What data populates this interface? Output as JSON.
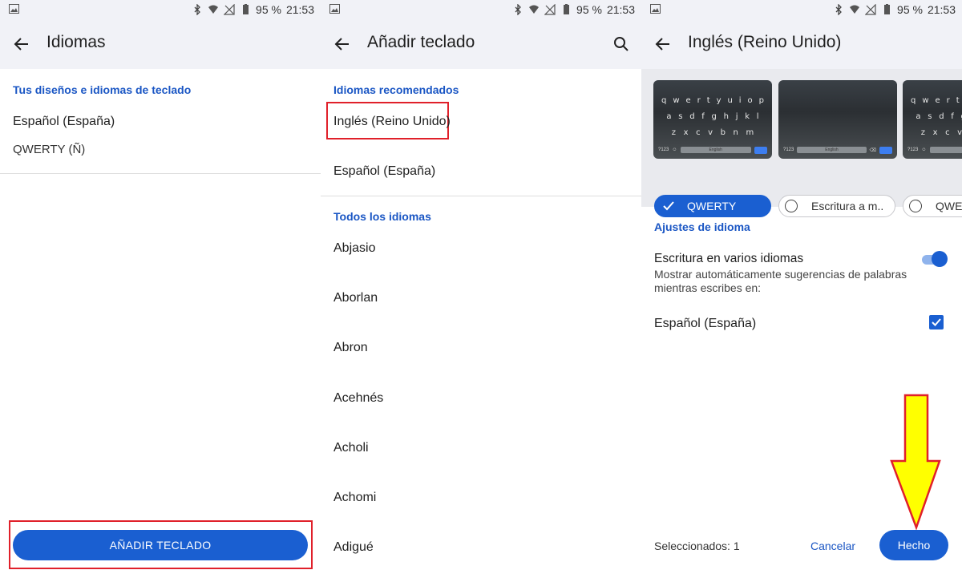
{
  "status_bar": {
    "battery": "95 %",
    "time": "21:53"
  },
  "panel1": {
    "title": "Idiomas",
    "section_header": "Tus diseños e idiomas de teclado",
    "language": "Español (España)",
    "layout": "QWERTY (Ñ)",
    "add_button": "AÑADIR TECLADO"
  },
  "panel2": {
    "title": "Añadir teclado",
    "recommended_header": "Idiomas recomendados",
    "recommended": [
      "Inglés (Reino Unido)",
      "Español (España)"
    ],
    "all_header": "Todos los idiomas",
    "languages": [
      "Abjasio",
      "Aborlan",
      "Abron",
      "Acehnés",
      "Acholi",
      "Achomi",
      "Adigué"
    ]
  },
  "panel3": {
    "title": "Inglés (Reino Unido)",
    "layout_options": [
      "QWERTY",
      "Escritura a m..",
      "QWE"
    ],
    "selected_layout": "QWERTY",
    "keyboard_rows": [
      [
        "q",
        "w",
        "e",
        "r",
        "t",
        "y",
        "u",
        "i",
        "o",
        "p"
      ],
      [
        "a",
        "s",
        "d",
        "f",
        "g",
        "h",
        "j",
        "k",
        "l"
      ],
      [
        "z",
        "x",
        "c",
        "v",
        "b",
        "n",
        "m"
      ]
    ],
    "keyboard_symbols_key": "?123",
    "keyboard_space_label": "English",
    "settings_header": "Ajustes de idioma",
    "multilang_title": "Escritura en varios idiomas",
    "multilang_desc": "Mostrar automáticamente sugerencias de palabras mientras escribes en:",
    "multilang_enabled": true,
    "secondary_language": "Español (España)",
    "secondary_checked": true,
    "selected_count": "Seleccionados: 1",
    "cancel_label": "Cancelar",
    "done_label": "Hecho"
  },
  "colors": {
    "accent": "#1a5fd1",
    "highlight_box": "#e0202a",
    "arrow_fill": "#ffff00"
  }
}
